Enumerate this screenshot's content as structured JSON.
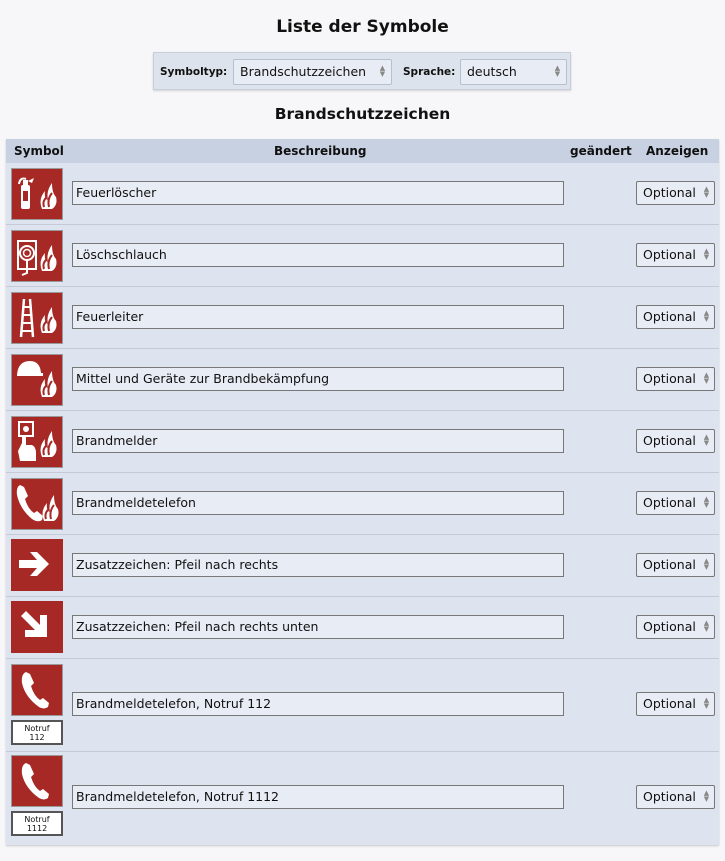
{
  "page": {
    "title": "Liste der Symbole"
  },
  "filters": {
    "symboltyp_label": "Symboltyp:",
    "symboltyp_value": "Brandschutzzeichen",
    "sprache_label": "Sprache:",
    "sprache_value": "deutsch"
  },
  "section": {
    "title": "Brandschutzzeichen"
  },
  "table": {
    "headers": {
      "symbol": "Symbol",
      "beschreibung": "Beschreibung",
      "geaendert": "geändert",
      "anzeigen": "Anzeigen"
    },
    "rows": [
      {
        "icon": "fire-extinguisher-icon",
        "description": "Feuerlöscher",
        "option": "Optional"
      },
      {
        "icon": "fire-hose-icon",
        "description": "Löschschlauch",
        "option": "Optional"
      },
      {
        "icon": "fire-ladder-icon",
        "description": "Feuerleiter",
        "option": "Optional"
      },
      {
        "icon": "firefighting-equipment-icon",
        "description": "Mittel und Geräte zur Brandbekämpfung",
        "option": "Optional"
      },
      {
        "icon": "fire-alarm-call-point-icon",
        "description": "Brandmelder",
        "option": "Optional"
      },
      {
        "icon": "fire-emergency-phone-icon",
        "description": "Brandmeldetelefon",
        "option": "Optional"
      },
      {
        "icon": "arrow-right-icon",
        "description": "Zusatzzeichen: Pfeil nach rechts",
        "option": "Optional"
      },
      {
        "icon": "arrow-down-right-icon",
        "description": "Zusatzzeichen: Pfeil nach rechts unten",
        "option": "Optional"
      },
      {
        "icon": "emergency-phone-icon",
        "description": "Brandmeldetelefon, Notruf 112",
        "option": "Optional",
        "sub_label_1": "Notruf",
        "sub_label_2": "112"
      },
      {
        "icon": "emergency-phone-icon",
        "description": "Brandmeldetelefon, Notruf 1112",
        "option": "Optional",
        "sub_label_1": "Notruf",
        "sub_label_2": "1112"
      }
    ]
  },
  "colors": {
    "sign_red": "#a72926",
    "table_bg": "#dde3ef",
    "header_bg": "#c8d1e2"
  }
}
